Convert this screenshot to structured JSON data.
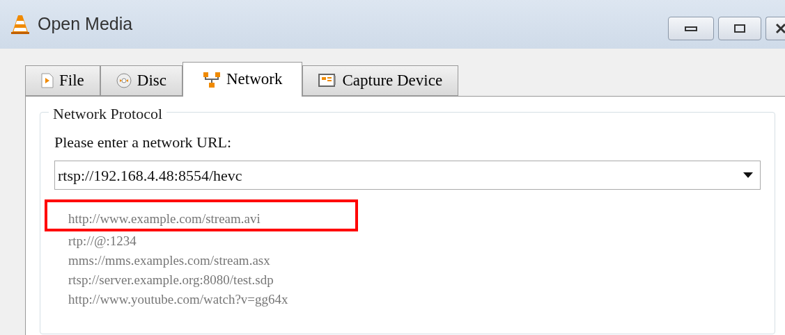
{
  "window": {
    "title": "Open Media"
  },
  "tabs": [
    {
      "label": "File",
      "selected": false
    },
    {
      "label": "Disc",
      "selected": false
    },
    {
      "label": "Network",
      "selected": true
    },
    {
      "label": "Capture Device",
      "selected": false
    }
  ],
  "group": {
    "title": "Network Protocol",
    "prompt": "Please enter a network URL:",
    "url": "rtsp://192.168.4.48:8554/hevc",
    "examples": [
      {
        "text": "http://www.example.com/stream.avi",
        "highlighted": true
      },
      {
        "text": "rtp://@:1234",
        "highlighted": false
      },
      {
        "text": "mms://mms.examples.com/stream.asx",
        "highlighted": false
      },
      {
        "text": "rtsp://server.example.org:8080/test.sdp",
        "highlighted": false
      },
      {
        "text": "http://www.youtube.com/watch?v=gg64x",
        "highlighted": false
      }
    ]
  }
}
